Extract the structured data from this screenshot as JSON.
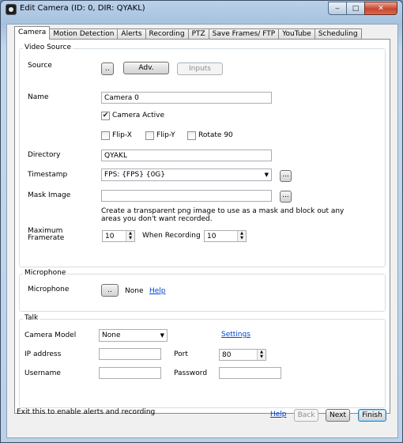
{
  "window": {
    "title": "Edit Camera (ID: 0, DIR: QYAKL)"
  },
  "tabs": [
    "Camera",
    "Motion Detection",
    "Alerts",
    "Recording",
    "PTZ",
    "Save Frames/ FTP",
    "YouTube",
    "Scheduling"
  ],
  "video_source": {
    "group_title": "Video Source",
    "source_label": "Source",
    "browse_label": "..",
    "adv_label": "Adv.",
    "inputs_label": "Inputs",
    "name_label": "Name",
    "name_value": "Camera 0",
    "camera_active_label": "Camera Active",
    "camera_active_checked": true,
    "flip_x_label": "Flip-X",
    "flip_y_label": "Flip-Y",
    "rotate_label": "Rotate 90",
    "directory_label": "Directory",
    "directory_value": "QYAKL",
    "timestamp_label": "Timestamp",
    "timestamp_value": "FPS: {FPS} {0G}",
    "timestamp_btn": "...",
    "mask_label": "Mask Image",
    "mask_value": "",
    "mask_btn": "...",
    "mask_hint": "Create a transparent png image to use as a mask and block out any areas you don't want recorded.",
    "max_framerate_label": "Maximum Framerate",
    "max_framerate_value": "10",
    "when_recording_label": "When Recording",
    "when_recording_value": "10"
  },
  "microphone": {
    "group_title": "Microphone",
    "label": "Microphone",
    "browse_label": "..",
    "value": "None",
    "help_label": "Help"
  },
  "talk": {
    "group_title": "Talk",
    "camera_model_label": "Camera Model",
    "camera_model_value": "None",
    "settings_label": "Settings",
    "ip_label": "IP address",
    "ip_value": "",
    "port_label": "Port",
    "port_value": "80",
    "username_label": "Username",
    "username_value": "",
    "password_label": "Password",
    "password_value": ""
  },
  "footer": {
    "status": "Exit this to enable alerts and recording",
    "help_label": "Help",
    "back_label": "Back",
    "next_label": "Next",
    "finish_label": "Finish"
  }
}
